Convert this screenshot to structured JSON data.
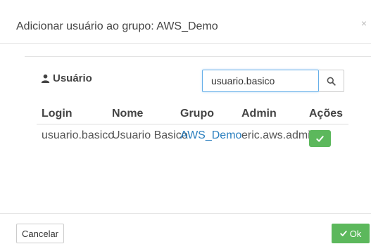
{
  "modal": {
    "title": "Adicionar usuário ao grupo: AWS_Demo",
    "close_glyph": "×"
  },
  "section": {
    "label": "Usuário",
    "icon": "user-icon"
  },
  "search": {
    "value": "usuario.basico",
    "icon": "search-icon"
  },
  "table": {
    "headers": [
      "Login",
      "Nome",
      "Grupo",
      "Admin",
      "Ações"
    ],
    "rows": [
      {
        "login": "usuario.basico",
        "nome": "Usuario Basico",
        "grupo": "AWS_Demo",
        "admin": "eric.aws.admin",
        "action_icon": "check-icon"
      }
    ]
  },
  "footer": {
    "cancel_label": "Cancelar",
    "ok_label": "Ok",
    "ok_icon": "check-icon"
  },
  "colors": {
    "success": "#5cb85c",
    "link": "#2a7fbf",
    "focus": "#66afe9"
  }
}
